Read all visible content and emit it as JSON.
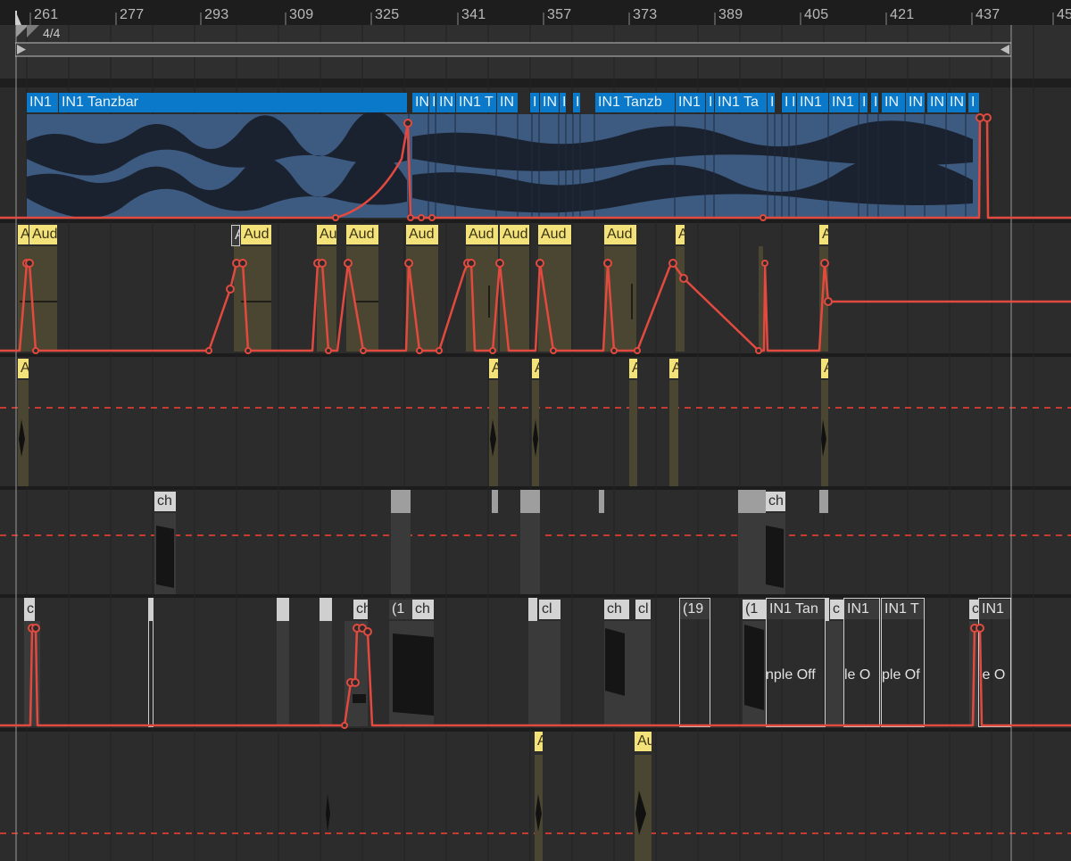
{
  "ruler": {
    "bars": [
      "261",
      "277",
      "293",
      "309",
      "325",
      "341",
      "357",
      "373",
      "389",
      "405",
      "421",
      "437",
      "45"
    ],
    "time_signature": "4/4"
  },
  "track1": {
    "clips": [
      {
        "label": "IN1"
      },
      {
        "label": "IN1 Tanzbar"
      },
      {
        "label": "IN"
      },
      {
        "label": "I"
      },
      {
        "label": "IN"
      },
      {
        "label": "IN1 T"
      },
      {
        "label": "IN"
      },
      {
        "label": "I"
      },
      {
        "label": "IN"
      },
      {
        "label": "I"
      },
      {
        "label": "I"
      },
      {
        "label": "IN1 Tanzb"
      },
      {
        "label": "IN1"
      },
      {
        "label": "I"
      },
      {
        "label": "IN1 Ta"
      },
      {
        "label": "I"
      },
      {
        "label": "I"
      },
      {
        "label": "I"
      },
      {
        "label": "IN1"
      },
      {
        "label": "IN1"
      },
      {
        "label": "I"
      },
      {
        "label": "I"
      },
      {
        "label": "IN"
      },
      {
        "label": "IN"
      },
      {
        "label": "IN"
      },
      {
        "label": "IN"
      },
      {
        "label": "I"
      }
    ]
  },
  "track2": {
    "clips": [
      {
        "label": "A"
      },
      {
        "label": "Aud"
      },
      {
        "label": "A"
      },
      {
        "label": "Aud"
      },
      {
        "label": "Au"
      },
      {
        "label": "Aud"
      },
      {
        "label": "Aud"
      },
      {
        "label": "Aud"
      },
      {
        "label": "Aud"
      },
      {
        "label": "Aud"
      },
      {
        "label": "Aud"
      },
      {
        "label": "A"
      },
      {
        "label": "A"
      }
    ]
  },
  "track3": {
    "clips": [
      {
        "label": "A"
      },
      {
        "label": "A"
      },
      {
        "label": "A"
      },
      {
        "label": "A"
      },
      {
        "label": "A"
      },
      {
        "label": "A"
      }
    ]
  },
  "track4": {
    "clips": [
      {
        "label": "ch"
      },
      {
        "label": "ch"
      }
    ]
  },
  "track5": {
    "clips": [
      {
        "label": "c"
      },
      {
        "label": "ch"
      },
      {
        "label": "(1"
      },
      {
        "label": "ch"
      },
      {
        "label": "cl"
      },
      {
        "label": "ch"
      },
      {
        "label": "cl"
      },
      {
        "label": "(19"
      },
      {
        "label": "(1"
      },
      {
        "label": "IN1 Tan"
      },
      {
        "label": "c"
      },
      {
        "label": "IN1"
      },
      {
        "label": "IN1 T"
      },
      {
        "label": "c"
      },
      {
        "label": "IN1"
      }
    ],
    "sample_offset_texts": [
      {
        "text": "nple Off"
      },
      {
        "text": "le O"
      },
      {
        "text": "ple Of"
      },
      {
        "text": "le O"
      }
    ]
  },
  "track6": {
    "clips": [
      {
        "label": "A"
      },
      {
        "label": "Au"
      }
    ]
  },
  "colors": {
    "clip_blue": "#0a79c9",
    "clip_yellow": "#f3e27a",
    "automation": "#e24a3f"
  }
}
